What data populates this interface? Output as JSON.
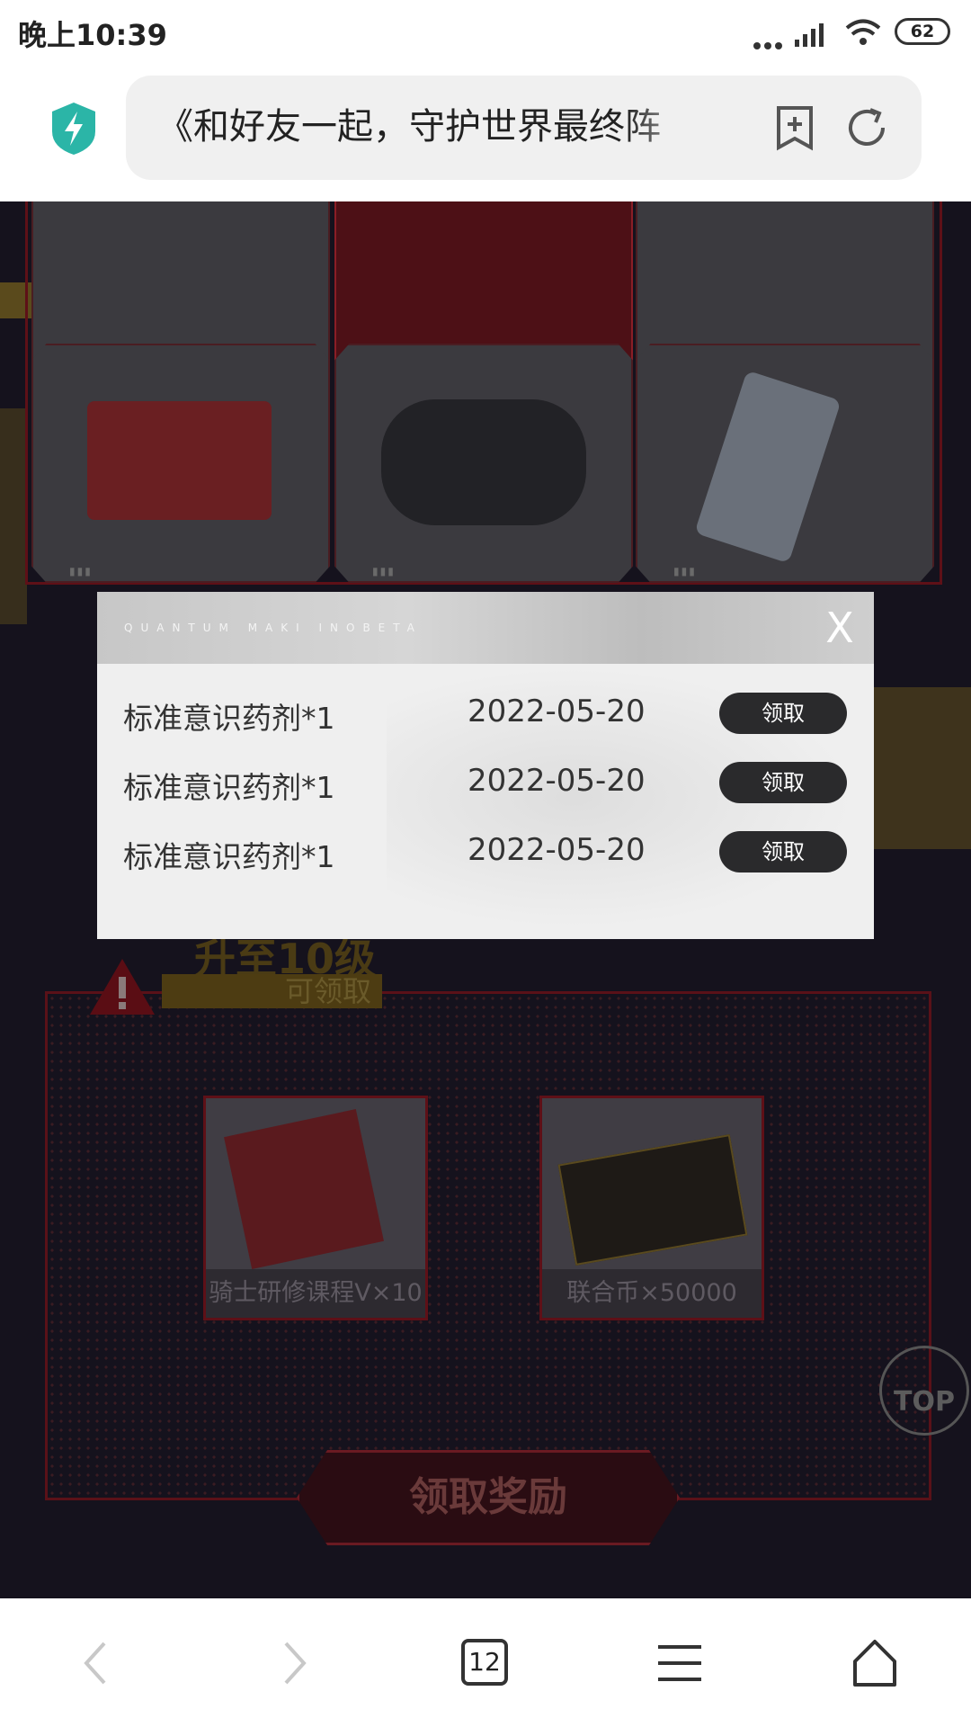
{
  "status_bar": {
    "time": "晚上10:39",
    "battery": "62"
  },
  "browser": {
    "url_title": "《和好友一起，守护世界最终阵",
    "tab_count": "12"
  },
  "page": {
    "level_text": "升至10级",
    "claimable_text": "可领取",
    "items": [
      {
        "label": "骑士研修课程V×10"
      },
      {
        "label": "联合币×50000"
      }
    ],
    "claim_reward_button": "领取奖励",
    "top_button": "TOP"
  },
  "modal": {
    "header_text": "QUANTUM MAKI INOBETA",
    "close_label": "X",
    "rows": [
      {
        "name": "标准意识药剂*1",
        "date": "2022-05-20",
        "button": "领取"
      },
      {
        "name": "标准意识药剂*1",
        "date": "2022-05-20",
        "button": "领取"
      },
      {
        "name": "标准意识药剂*1",
        "date": "2022-05-20",
        "button": "领取"
      }
    ]
  }
}
